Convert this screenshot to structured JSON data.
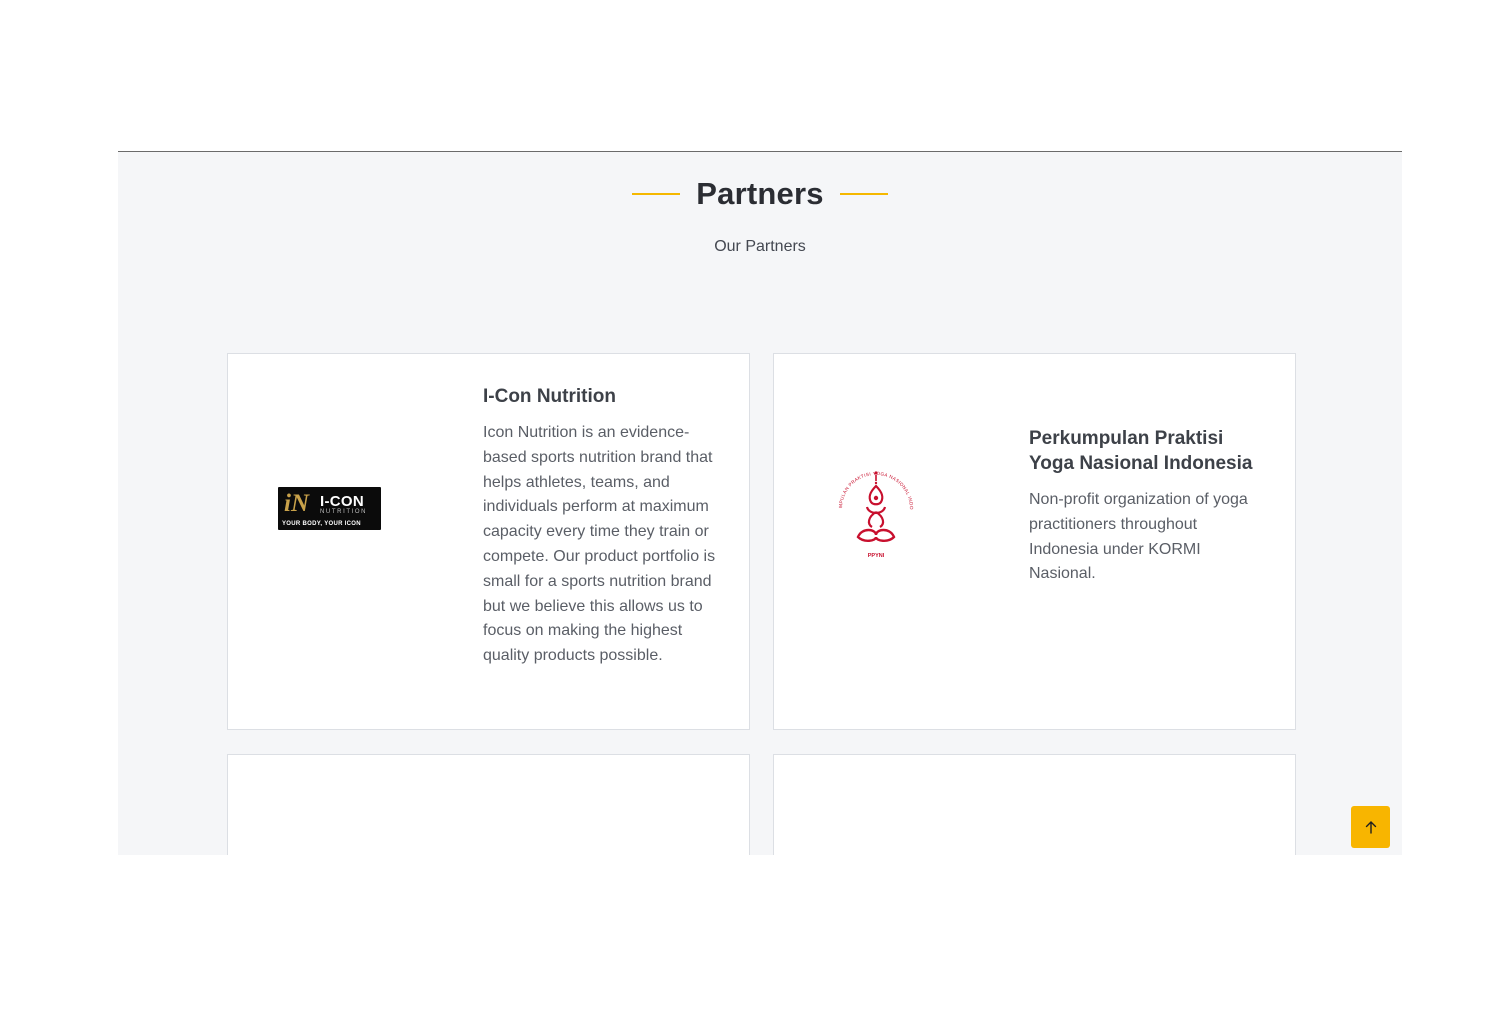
{
  "section": {
    "title": "Partners",
    "subtitle": "Our Partners",
    "accent_color": "#f5b800"
  },
  "partners": [
    {
      "name": "I-Con Nutrition",
      "description": "Icon Nutrition is an evidence-based sports nutrition brand that helps athletes, teams, and individuals perform at maximum capacity every time they train or compete. Our product portfolio is small for a sports nutrition brand but we believe this allows us to focus on making the highest quality products possible.",
      "logo": {
        "icon": "icon-nutrition-logo",
        "mark": "iN",
        "name": "I-CON",
        "sub": "NUTRITION",
        "tagline": "YOUR BODY, YOUR ICON"
      }
    },
    {
      "name": "Perkumpulan Praktisi Yoga Nasional Indonesia",
      "description": "Non-profit organization of yoga practitioners throughout Indonesia under KORMI Nasional.",
      "logo": {
        "icon": "ppyni-yoga-logo",
        "arc_text": "PERKUMPULAN PRAKTISI YOGA NASIONAL INDONESIA",
        "abbr": "PPYNI",
        "color": "#c8102e"
      }
    }
  ],
  "scroll_top": {
    "icon": "arrow-up-icon",
    "color": "#f8b500"
  }
}
